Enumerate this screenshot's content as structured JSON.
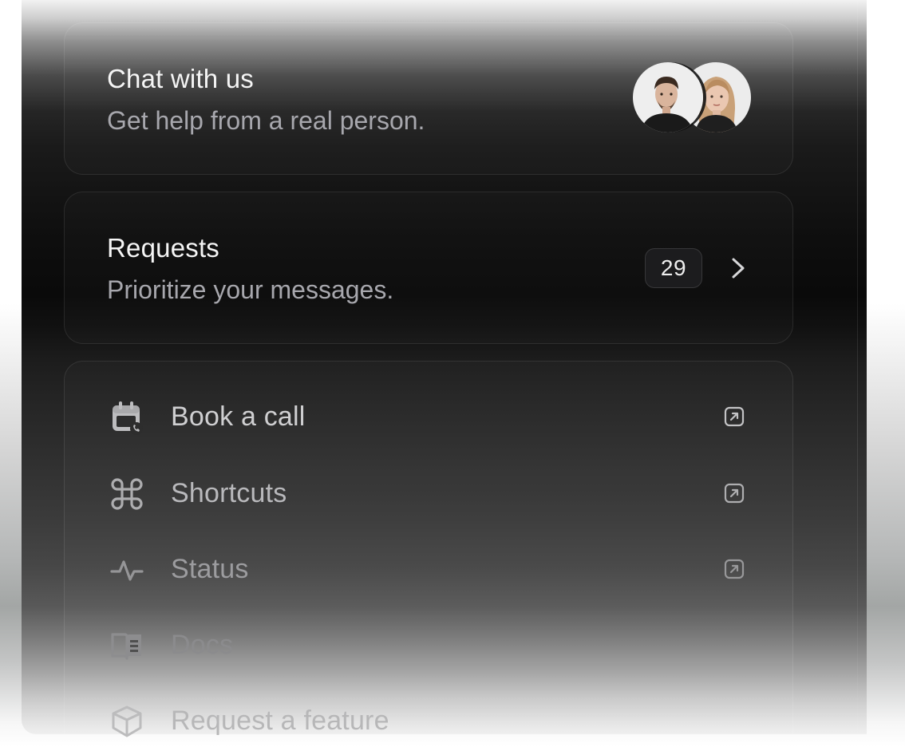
{
  "chat": {
    "title": "Chat with us",
    "subtitle": "Get help from a real person.",
    "avatars": [
      "support-agent-man-avatar",
      "support-agent-woman-avatar"
    ]
  },
  "requests": {
    "title": "Requests",
    "subtitle": "Prioritize your messages.",
    "count": "29",
    "chevron_icon": "chevron-right-icon"
  },
  "links": [
    {
      "label": "Book a call",
      "icon": "calendar-phone-icon",
      "external": true
    },
    {
      "label": "Shortcuts",
      "icon": "command-icon",
      "external": true
    },
    {
      "label": "Status",
      "icon": "activity-pulse-icon",
      "external": true
    },
    {
      "label": "Docs",
      "icon": "book-open-icon",
      "external": false
    },
    {
      "label": "Request a feature",
      "icon": "package-box-icon",
      "external": false
    }
  ],
  "colors": {
    "panel_dark": "#0a0a0a",
    "text_primary": "#f5f5f5",
    "text_secondary": "#a7a7ad",
    "badge_bg": "#1c1c1e"
  }
}
